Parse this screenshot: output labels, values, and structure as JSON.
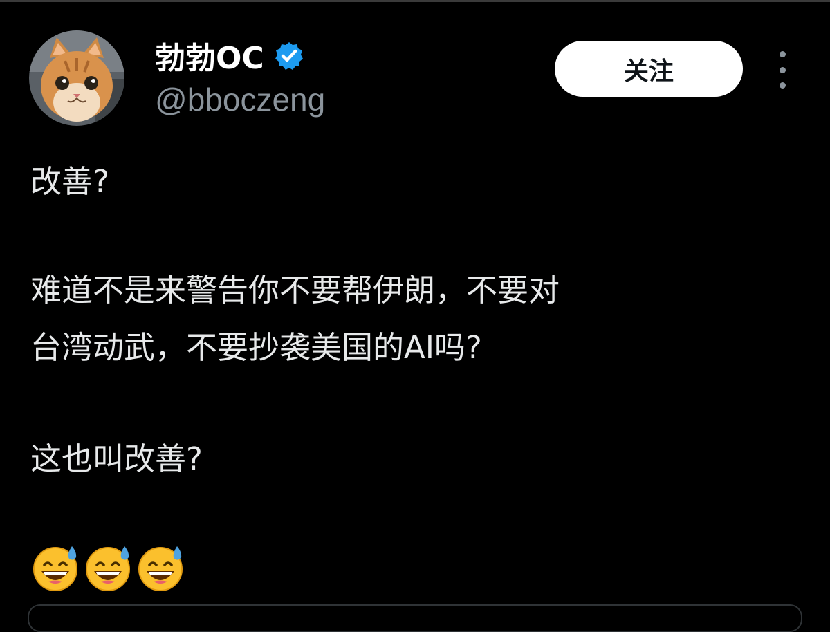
{
  "user": {
    "display_name": "勃勃OC",
    "handle": "@bboczeng",
    "verified": true,
    "avatar_icon": "cat-avatar",
    "badge_icon": "verified-badge-icon",
    "badge_color": "#1d9bf0"
  },
  "actions": {
    "follow_label": "关注",
    "more_icon": "more-options-icon"
  },
  "tweet": {
    "lines": [
      "改善?",
      "难道不是来警告你不要帮伊朗，不要对",
      "台湾动武，不要抄袭美国的AI吗?",
      "这也叫改善?"
    ],
    "emojis": [
      "grinning-face-with-sweat",
      "grinning-face-with-sweat",
      "grinning-face-with-sweat"
    ]
  },
  "colors": {
    "background": "#000000",
    "text": "#e7e9ea",
    "secondary_text": "#8b949c",
    "accent": "#1d9bf0",
    "button_bg": "#ffffff",
    "button_text": "#0f1419"
  }
}
